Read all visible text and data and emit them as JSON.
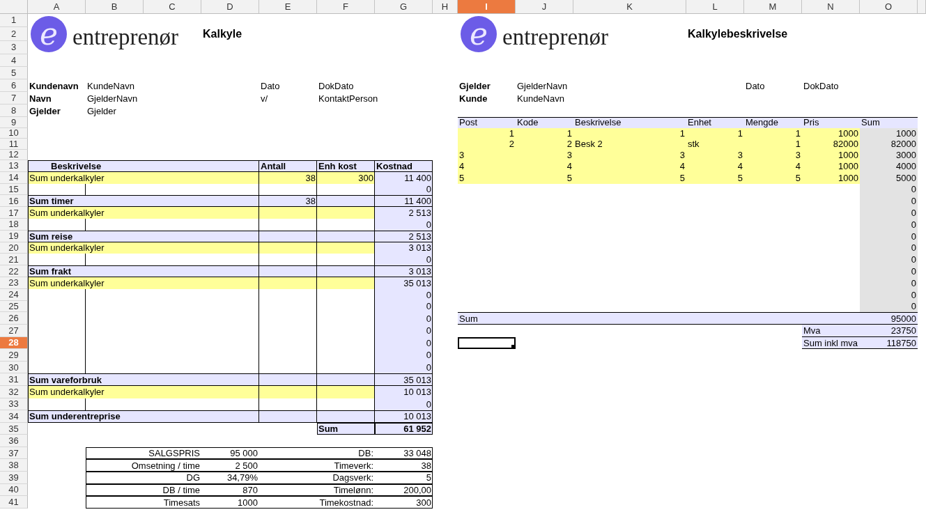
{
  "columns": [
    {
      "label": "A",
      "selected": false
    },
    {
      "label": "B",
      "selected": false
    },
    {
      "label": "C",
      "selected": false
    },
    {
      "label": "D",
      "selected": false
    },
    {
      "label": "E",
      "selected": false
    },
    {
      "label": "F",
      "selected": false
    },
    {
      "label": "G",
      "selected": false
    },
    {
      "label": "H",
      "selected": false
    },
    {
      "label": "I",
      "selected": true
    },
    {
      "label": "J",
      "selected": false
    },
    {
      "label": "K",
      "selected": false
    },
    {
      "label": "L",
      "selected": false
    },
    {
      "label": "M",
      "selected": false
    },
    {
      "label": "N",
      "selected": false
    },
    {
      "label": "O",
      "selected": false
    }
  ],
  "rows": [
    {
      "label": "1",
      "selected": false,
      "cells": {
        "A": {
          "kind": "logo",
          "mark": "e",
          "text": "entreprenør"
        },
        "I": {
          "kind": "logo",
          "mark": "e",
          "text": "entreprenør"
        }
      }
    },
    {
      "label": "2",
      "selected": false,
      "cells": {
        "D": {
          "kind": "title",
          "text": "Kalkyle"
        },
        "L": {
          "kind": "title",
          "text": "Kalkylebeskrivelse"
        }
      }
    },
    {
      "label": "3",
      "selected": false
    },
    {
      "label": "4",
      "selected": false
    },
    {
      "label": "5",
      "selected": false
    },
    {
      "label": "6",
      "selected": false,
      "cells": {
        "A": {
          "kind": "label",
          "text": "Kundenavn"
        },
        "B": {
          "kind": "text",
          "text": "KundeNavn"
        },
        "E": {
          "kind": "text",
          "text": "Dato"
        },
        "F": {
          "kind": "text",
          "text": "DokDato"
        },
        "I": {
          "kind": "label",
          "text": "Gjelder"
        },
        "J": {
          "kind": "text",
          "text": "GjelderNavn"
        },
        "M": {
          "kind": "text",
          "text": "Dato"
        },
        "N": {
          "kind": "text",
          "text": "DokDato"
        }
      }
    },
    {
      "label": "7",
      "selected": false,
      "cells": {
        "A": {
          "kind": "label",
          "text": "Navn"
        },
        "B": {
          "kind": "text",
          "text": "GjelderNavn"
        },
        "E": {
          "kind": "text",
          "text": "v/"
        },
        "F": {
          "kind": "text",
          "text": "KontaktPerson"
        },
        "I": {
          "kind": "label",
          "text": "Kunde"
        },
        "J": {
          "kind": "text",
          "text": "KundeNavn"
        }
      }
    },
    {
      "label": "8",
      "selected": false,
      "cells": {
        "A": {
          "kind": "label",
          "text": "Gjelder"
        },
        "B": {
          "kind": "text",
          "text": "Gjelder"
        }
      }
    },
    {
      "label": "9",
      "selected": false,
      "right": {
        "kind": "head"
      },
      "cells": {
        "I": {
          "kind": "text",
          "text": "Post",
          "color": "#e6e6ff"
        },
        "J": {
          "kind": "text",
          "text": "Kode",
          "color": "#e6e6ff"
        },
        "K": {
          "kind": "text",
          "text": "Beskrivelse",
          "color": "#e6e6ff"
        },
        "L": {
          "kind": "text",
          "text": "Enhet",
          "color": "#e6e6ff"
        },
        "M": {
          "kind": "text",
          "text": "Mengde",
          "color": "#e6e6ff"
        },
        "N": {
          "kind": "text",
          "text": "Pris",
          "color": "#e6e6ff"
        },
        "O": {
          "kind": "text",
          "text": "Sum",
          "color": "#e6e6ff"
        }
      }
    },
    {
      "label": "10",
      "selected": false,
      "cells": {
        "I": {
          "kind": "number",
          "text": "1",
          "color": "#ffff99"
        },
        "J": {
          "kind": "number",
          "text": "1",
          "color": "#ffff99"
        },
        "K": {
          "kind": "number",
          "text": "1",
          "color": "#ffff99"
        },
        "L": {
          "kind": "number",
          "text": "1",
          "color": "#ffff99"
        },
        "M": {
          "kind": "number",
          "text": "1",
          "color": "#ffff99"
        },
        "N": {
          "kind": "number",
          "text": "1000",
          "color": "#ffff99"
        },
        "O": {
          "kind": "number",
          "text": "1000",
          "color": "#e3e3e3"
        }
      }
    },
    {
      "label": "11",
      "selected": false,
      "cells": {
        "I": {
          "kind": "number",
          "text": "2",
          "color": "#ffff99"
        },
        "J": {
          "kind": "number",
          "text": "2",
          "color": "#ffff99"
        },
        "K": {
          "kind": "text",
          "text": "Besk 2",
          "color": "#ffff99"
        },
        "L": {
          "kind": "text",
          "text": "stk",
          "color": "#ffff99"
        },
        "M": {
          "kind": "number",
          "text": "1",
          "color": "#ffff99"
        },
        "N": {
          "kind": "number",
          "text": "82000",
          "color": "#ffff99"
        },
        "O": {
          "kind": "number",
          "text": "82000",
          "color": "#e3e3e3"
        }
      }
    },
    {
      "label": "12",
      "selected": false,
      "cells": {
        "I": {
          "kind": "text",
          "text": "3",
          "color": "#ffff99"
        },
        "J": {
          "kind": "number",
          "text": "3",
          "color": "#ffff99"
        },
        "K": {
          "kind": "number",
          "text": "3",
          "color": "#ffff99"
        },
        "L": {
          "kind": "number",
          "text": "3",
          "color": "#ffff99"
        },
        "M": {
          "kind": "number",
          "text": "3",
          "color": "#ffff99"
        },
        "N": {
          "kind": "number",
          "text": "1000",
          "color": "#ffff99"
        },
        "O": {
          "kind": "number",
          "text": "3000",
          "color": "#e3e3e3"
        }
      }
    },
    {
      "label": "13",
      "selected": false,
      "kind": "head",
      "cells": {
        "A": {
          "kind": "heading",
          "text": "Beskrivelse",
          "color": "#e6e6ff"
        },
        "B": {
          "color": "#e6e6ff"
        },
        "C": {
          "color": "#e6e6ff"
        },
        "D": {
          "color": "#e6e6ff"
        },
        "E": {
          "kind": "label",
          "text": "Antall",
          "color": "#e6e6ff"
        },
        "F": {
          "kind": "label",
          "text": "Enh kost",
          "color": "#e6e6ff"
        },
        "G": {
          "kind": "label",
          "text": "Kostnad",
          "color": "#e6e6ff"
        },
        "I": {
          "kind": "text",
          "text": "4",
          "color": "#ffff99"
        },
        "J": {
          "kind": "number",
          "text": "4",
          "color": "#ffff99"
        },
        "K": {
          "kind": "number",
          "text": "4",
          "color": "#ffff99"
        },
        "L": {
          "kind": "number",
          "text": "4",
          "color": "#ffff99"
        },
        "M": {
          "kind": "number",
          "text": "4",
          "color": "#ffff99"
        },
        "N": {
          "kind": "number",
          "text": "1000",
          "color": "#ffff99"
        },
        "O": {
          "kind": "number",
          "text": "4000",
          "color": "#e3e3e3"
        }
      }
    },
    {
      "label": "14",
      "selected": false,
      "kind": "item",
      "cells": {
        "A": {
          "kind": "text",
          "text": "Sum underkalkyler",
          "color": "#ffff99"
        },
        "B": {
          "color": "#ffff99"
        },
        "C": {
          "color": "#ffff99"
        },
        "D": {
          "color": "#ffff99"
        },
        "E": {
          "kind": "number",
          "text": "38",
          "color": "#ffff99"
        },
        "F": {
          "kind": "number",
          "text": "300",
          "color": "#ffff99"
        },
        "G": {
          "kind": "number",
          "text": "11 400",
          "color": "#e6e6ff"
        },
        "I": {
          "kind": "text",
          "text": "5",
          "color": "#ffff99"
        },
        "J": {
          "kind": "number",
          "text": "5",
          "color": "#ffff99"
        },
        "K": {
          "kind": "number",
          "text": "5",
          "color": "#ffff99"
        },
        "L": {
          "kind": "number",
          "text": "5",
          "color": "#ffff99"
        },
        "M": {
          "kind": "number",
          "text": "5",
          "color": "#ffff99"
        },
        "N": {
          "kind": "number",
          "text": "1000",
          "color": "#ffff99"
        },
        "O": {
          "kind": "number",
          "text": "5000",
          "color": "#e3e3e3"
        }
      }
    },
    {
      "label": "15",
      "selected": false,
      "kind": "gap",
      "cells": {
        "G": {
          "kind": "number",
          "text": "0",
          "color": "#e6e6ff"
        },
        "O": {
          "kind": "number",
          "text": "0",
          "color": "#e3e3e3"
        }
      }
    },
    {
      "label": "16",
      "selected": false,
      "kind": "sum",
      "cells": {
        "A": {
          "kind": "label",
          "text": "Sum timer",
          "color": "#e6e6ff"
        },
        "B": {
          "color": "#e6e6ff"
        },
        "C": {
          "color": "#e6e6ff"
        },
        "D": {
          "color": "#e6e6ff"
        },
        "E": {
          "kind": "number",
          "text": "38",
          "color": "#e6e6ff"
        },
        "F": {
          "color": "#e6e6ff"
        },
        "G": {
          "kind": "number",
          "text": "11 400",
          "color": "#e6e6ff"
        },
        "O": {
          "kind": "number",
          "text": "0",
          "color": "#e3e3e3"
        }
      }
    },
    {
      "label": "17",
      "selected": false,
      "kind": "item",
      "cells": {
        "A": {
          "kind": "text",
          "text": "Sum underkalkyler",
          "color": "#ffff99"
        },
        "B": {
          "color": "#ffff99"
        },
        "C": {
          "color": "#ffff99"
        },
        "D": {
          "color": "#ffff99"
        },
        "E": {
          "color": "#ffff99"
        },
        "F": {
          "color": "#ffff99"
        },
        "G": {
          "kind": "number",
          "text": "2 513",
          "color": "#e6e6ff"
        },
        "O": {
          "kind": "number",
          "text": "0",
          "color": "#e3e3e3"
        }
      }
    },
    {
      "label": "18",
      "selected": false,
      "kind": "gap",
      "cells": {
        "G": {
          "kind": "number",
          "text": "0",
          "color": "#e6e6ff"
        },
        "O": {
          "kind": "number",
          "text": "0",
          "color": "#e3e3e3"
        }
      }
    },
    {
      "label": "19",
      "selected": false,
      "kind": "sum",
      "cells": {
        "A": {
          "kind": "label",
          "text": "Sum reise",
          "color": "#e6e6ff"
        },
        "B": {
          "color": "#e6e6ff"
        },
        "C": {
          "color": "#e6e6ff"
        },
        "D": {
          "color": "#e6e6ff"
        },
        "E": {
          "color": "#e6e6ff"
        },
        "F": {
          "color": "#e6e6ff"
        },
        "G": {
          "kind": "number",
          "text": "2 513",
          "color": "#e6e6ff"
        },
        "O": {
          "kind": "number",
          "text": "0",
          "color": "#e3e3e3"
        }
      }
    },
    {
      "label": "20",
      "selected": false,
      "kind": "item",
      "cells": {
        "A": {
          "kind": "text",
          "text": "Sum underkalkyler",
          "color": "#ffff99"
        },
        "B": {
          "color": "#ffff99"
        },
        "C": {
          "color": "#ffff99"
        },
        "D": {
          "color": "#ffff99"
        },
        "E": {
          "color": "#ffff99"
        },
        "F": {
          "color": "#ffff99"
        },
        "G": {
          "kind": "number",
          "text": "3 013",
          "color": "#e6e6ff"
        },
        "O": {
          "kind": "number",
          "text": "0",
          "color": "#e3e3e3"
        }
      }
    },
    {
      "label": "21",
      "selected": false,
      "kind": "gap",
      "cells": {
        "G": {
          "kind": "number",
          "text": "0",
          "color": "#e6e6ff"
        },
        "O": {
          "kind": "number",
          "text": "0",
          "color": "#e3e3e3"
        }
      }
    },
    {
      "label": "22",
      "selected": false,
      "kind": "sum",
      "cells": {
        "A": {
          "kind": "label",
          "text": "Sum frakt",
          "color": "#e6e6ff"
        },
        "B": {
          "color": "#e6e6ff"
        },
        "C": {
          "color": "#e6e6ff"
        },
        "D": {
          "color": "#e6e6ff"
        },
        "E": {
          "color": "#e6e6ff"
        },
        "F": {
          "color": "#e6e6ff"
        },
        "G": {
          "kind": "number",
          "text": "3 013",
          "color": "#e6e6ff"
        },
        "O": {
          "kind": "number",
          "text": "0",
          "color": "#e3e3e3"
        }
      }
    },
    {
      "label": "23",
      "selected": false,
      "kind": "item",
      "cells": {
        "A": {
          "kind": "text",
          "text": "Sum underkalkyler",
          "color": "#ffff99"
        },
        "B": {
          "color": "#ffff99"
        },
        "C": {
          "color": "#ffff99"
        },
        "D": {
          "color": "#ffff99"
        },
        "E": {
          "color": "#ffff99"
        },
        "F": {
          "color": "#ffff99"
        },
        "G": {
          "kind": "number",
          "text": "35 013",
          "color": "#e6e6ff"
        },
        "O": {
          "kind": "number",
          "text": "0",
          "color": "#e3e3e3"
        }
      }
    },
    {
      "label": "24",
      "selected": false,
      "kind": "gap",
      "cells": {
        "G": {
          "kind": "number",
          "text": "0",
          "color": "#e6e6ff"
        },
        "O": {
          "kind": "number",
          "text": "0",
          "color": "#e3e3e3"
        }
      }
    },
    {
      "label": "25",
      "selected": false,
      "kind": "gap",
      "cells": {
        "G": {
          "kind": "number",
          "text": "0",
          "color": "#e6e6ff"
        },
        "O": {
          "kind": "number",
          "text": "0",
          "color": "#e3e3e3"
        }
      }
    },
    {
      "label": "26",
      "selected": false,
      "kind": "gap",
      "right": {
        "kind": "sum"
      },
      "cells": {
        "G": {
          "kind": "number",
          "text": "0",
          "color": "#e6e6ff"
        },
        "I": {
          "kind": "text",
          "text": "Sum",
          "color": "#e6e6ff"
        },
        "J": {
          "color": "#e6e6ff"
        },
        "K": {
          "color": "#e6e6ff"
        },
        "L": {
          "color": "#e6e6ff"
        },
        "M": {
          "color": "#e6e6ff"
        },
        "N": {
          "color": "#e6e6ff"
        },
        "O": {
          "kind": "number",
          "text": "95000",
          "color": "#e6e6ff"
        }
      }
    },
    {
      "label": "27",
      "selected": false,
      "kind": "gap",
      "right": {
        "kind": "vat"
      },
      "cells": {
        "G": {
          "kind": "number",
          "text": "0",
          "color": "#e6e6ff"
        },
        "N": {
          "kind": "text",
          "text": "Mva",
          "color": "#e6e6ff"
        },
        "O": {
          "kind": "number",
          "text": "23750",
          "color": "#e6e6ff"
        }
      }
    },
    {
      "label": "28",
      "selected": true,
      "kind": "gap",
      "right": {
        "kind": "vat"
      },
      "cells": {
        "G": {
          "kind": "number",
          "text": "0",
          "color": "#e6e6ff"
        },
        "N": {
          "kind": "text",
          "text": "Sum inkl mva",
          "color": "#e6e6ff"
        },
        "O": {
          "kind": "number",
          "text": "118750",
          "color": "#e6e6ff"
        }
      }
    },
    {
      "label": "29",
      "selected": false,
      "kind": "gap",
      "cells": {
        "G": {
          "kind": "number",
          "text": "0",
          "color": "#e6e6ff"
        }
      }
    },
    {
      "label": "30",
      "selected": false,
      "kind": "gap",
      "cells": {
        "G": {
          "kind": "number",
          "text": "0",
          "color": "#e6e6ff"
        }
      }
    },
    {
      "label": "31",
      "selected": false,
      "kind": "sum",
      "cells": {
        "A": {
          "kind": "label",
          "text": "Sum vareforbruk",
          "color": "#e6e6ff"
        },
        "B": {
          "color": "#e6e6ff"
        },
        "C": {
          "color": "#e6e6ff"
        },
        "D": {
          "color": "#e6e6ff"
        },
        "E": {
          "color": "#e6e6ff"
        },
        "F": {
          "color": "#e6e6ff"
        },
        "G": {
          "kind": "number",
          "text": "35 013",
          "color": "#e6e6ff"
        }
      }
    },
    {
      "label": "32",
      "selected": false,
      "kind": "item",
      "cells": {
        "A": {
          "kind": "text",
          "text": "Sum underkalkyler",
          "color": "#ffff99"
        },
        "B": {
          "color": "#ffff99"
        },
        "C": {
          "color": "#ffff99"
        },
        "D": {
          "color": "#ffff99"
        },
        "E": {
          "color": "#ffff99"
        },
        "F": {
          "color": "#ffff99"
        },
        "G": {
          "kind": "number",
          "text": "10 013",
          "color": "#e6e6ff"
        }
      }
    },
    {
      "label": "33",
      "selected": false,
      "kind": "gap",
      "cells": {
        "G": {
          "kind": "number",
          "text": "0",
          "color": "#e6e6ff"
        }
      }
    },
    {
      "label": "34",
      "selected": false,
      "kind": "sum",
      "cells": {
        "A": {
          "kind": "label",
          "text": "Sum underentreprise",
          "color": "#e6e6ff"
        },
        "B": {
          "color": "#e6e6ff"
        },
        "C": {
          "color": "#e6e6ff"
        },
        "D": {
          "color": "#e6e6ff"
        },
        "E": {
          "color": "#e6e6ff"
        },
        "F": {
          "color": "#e6e6ff"
        },
        "G": {
          "kind": "number",
          "text": "10 013",
          "color": "#e6e6ff"
        }
      }
    },
    {
      "label": "35",
      "selected": false,
      "kind": "total",
      "cells": {
        "F": {
          "kind": "label",
          "text": "Sum",
          "color": "#e6e6ff"
        },
        "G": {
          "kind": "total",
          "text": "61 952",
          "color": "#e6e6ff"
        }
      }
    },
    {
      "label": "36",
      "selected": false
    },
    {
      "label": "37",
      "selected": false,
      "kind": "stat",
      "cells": {
        "C": {
          "kind": "right",
          "text": "SALGSPRIS"
        },
        "D": {
          "kind": "number",
          "text": "95 000"
        },
        "F": {
          "kind": "right",
          "text": "DB:"
        },
        "G": {
          "kind": "number",
          "text": "33 048"
        }
      }
    },
    {
      "label": "38",
      "selected": false,
      "kind": "stat",
      "cells": {
        "C": {
          "kind": "right",
          "text": "Omsetning / time"
        },
        "D": {
          "kind": "number",
          "text": "2 500"
        },
        "F": {
          "kind": "right",
          "text": "Timeverk:"
        },
        "G": {
          "kind": "number",
          "text": "38"
        }
      }
    },
    {
      "label": "39",
      "selected": false,
      "kind": "stat",
      "cells": {
        "C": {
          "kind": "right",
          "text": "DG"
        },
        "D": {
          "kind": "number",
          "text": "34,79%"
        },
        "F": {
          "kind": "right",
          "text": "Dagsverk:"
        },
        "G": {
          "kind": "number",
          "text": "5"
        }
      }
    },
    {
      "label": "40",
      "selected": false,
      "kind": "stat",
      "cells": {
        "C": {
          "kind": "right",
          "text": "DB / time"
        },
        "D": {
          "kind": "number",
          "text": "870"
        },
        "F": {
          "kind": "right",
          "text": "Timelønn:"
        },
        "G": {
          "kind": "number",
          "text": "200,00"
        }
      }
    },
    {
      "label": "41",
      "selected": false,
      "kind": "stat",
      "cells": {
        "C": {
          "kind": "right",
          "text": "Timesats"
        },
        "D": {
          "kind": "number",
          "text": "1000"
        },
        "F": {
          "kind": "right",
          "text": "Timekostnad:"
        },
        "G": {
          "kind": "number",
          "text": "300"
        }
      }
    }
  ]
}
